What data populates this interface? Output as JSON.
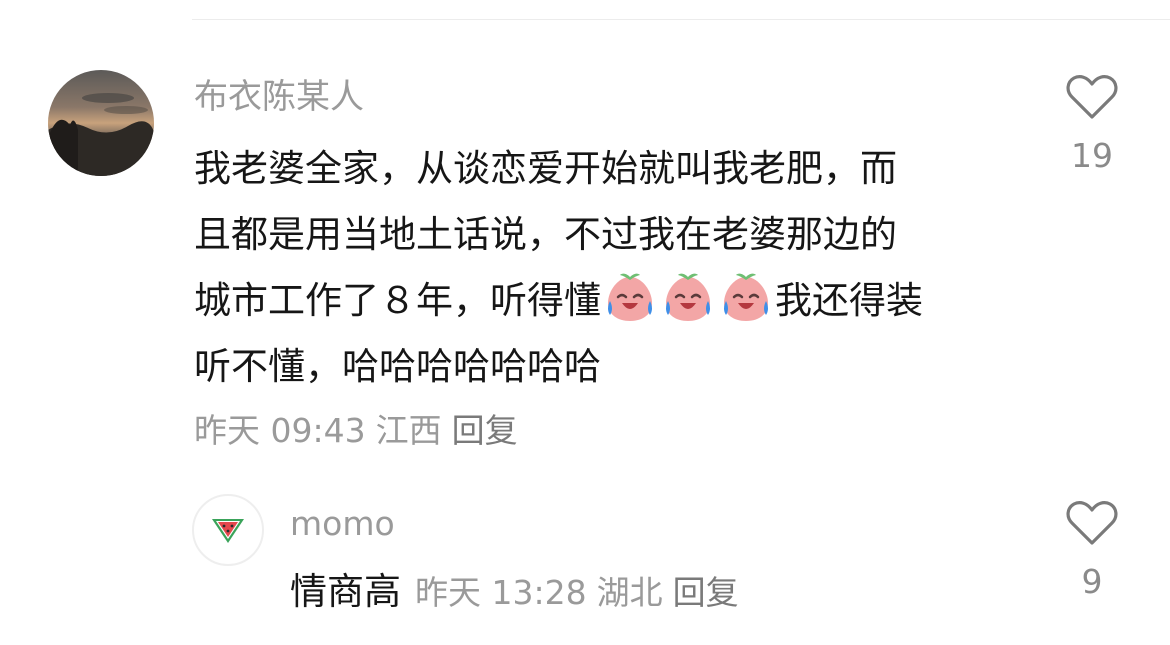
{
  "comment": {
    "author": "布衣陈某人",
    "text_lines": {
      "l1": "我老婆全家，从谈恋爱开始就叫我老肥，而",
      "l2": "且都是用当地土话说，不过我在老婆那边的",
      "l3_before": "城市工作了８年，听得懂",
      "l3_after": "我还得装",
      "l4": "听不懂，哈哈哈哈哈哈哈"
    },
    "emoji": "crying-laughing-peach-emoji",
    "time": "昨天 09:43",
    "location": "江西",
    "reply_label": "回复",
    "likes": "19",
    "like_icon": "heart-outline-icon"
  },
  "reply": {
    "author": "momo",
    "avatar_icon": "watermelon-icon",
    "text": "情商高",
    "time": "昨天 13:28",
    "location": "湖北",
    "reply_label": "回复",
    "likes": "9",
    "like_icon": "heart-outline-icon"
  },
  "colors": {
    "text_primary": "#161616",
    "text_secondary": "#9a9a9a",
    "divider": "#ececec",
    "emoji_peach": "#f3a6a6",
    "emoji_tear": "#3f8fe8",
    "watermelon_red": "#e5484d",
    "watermelon_green": "#3aa35a"
  }
}
